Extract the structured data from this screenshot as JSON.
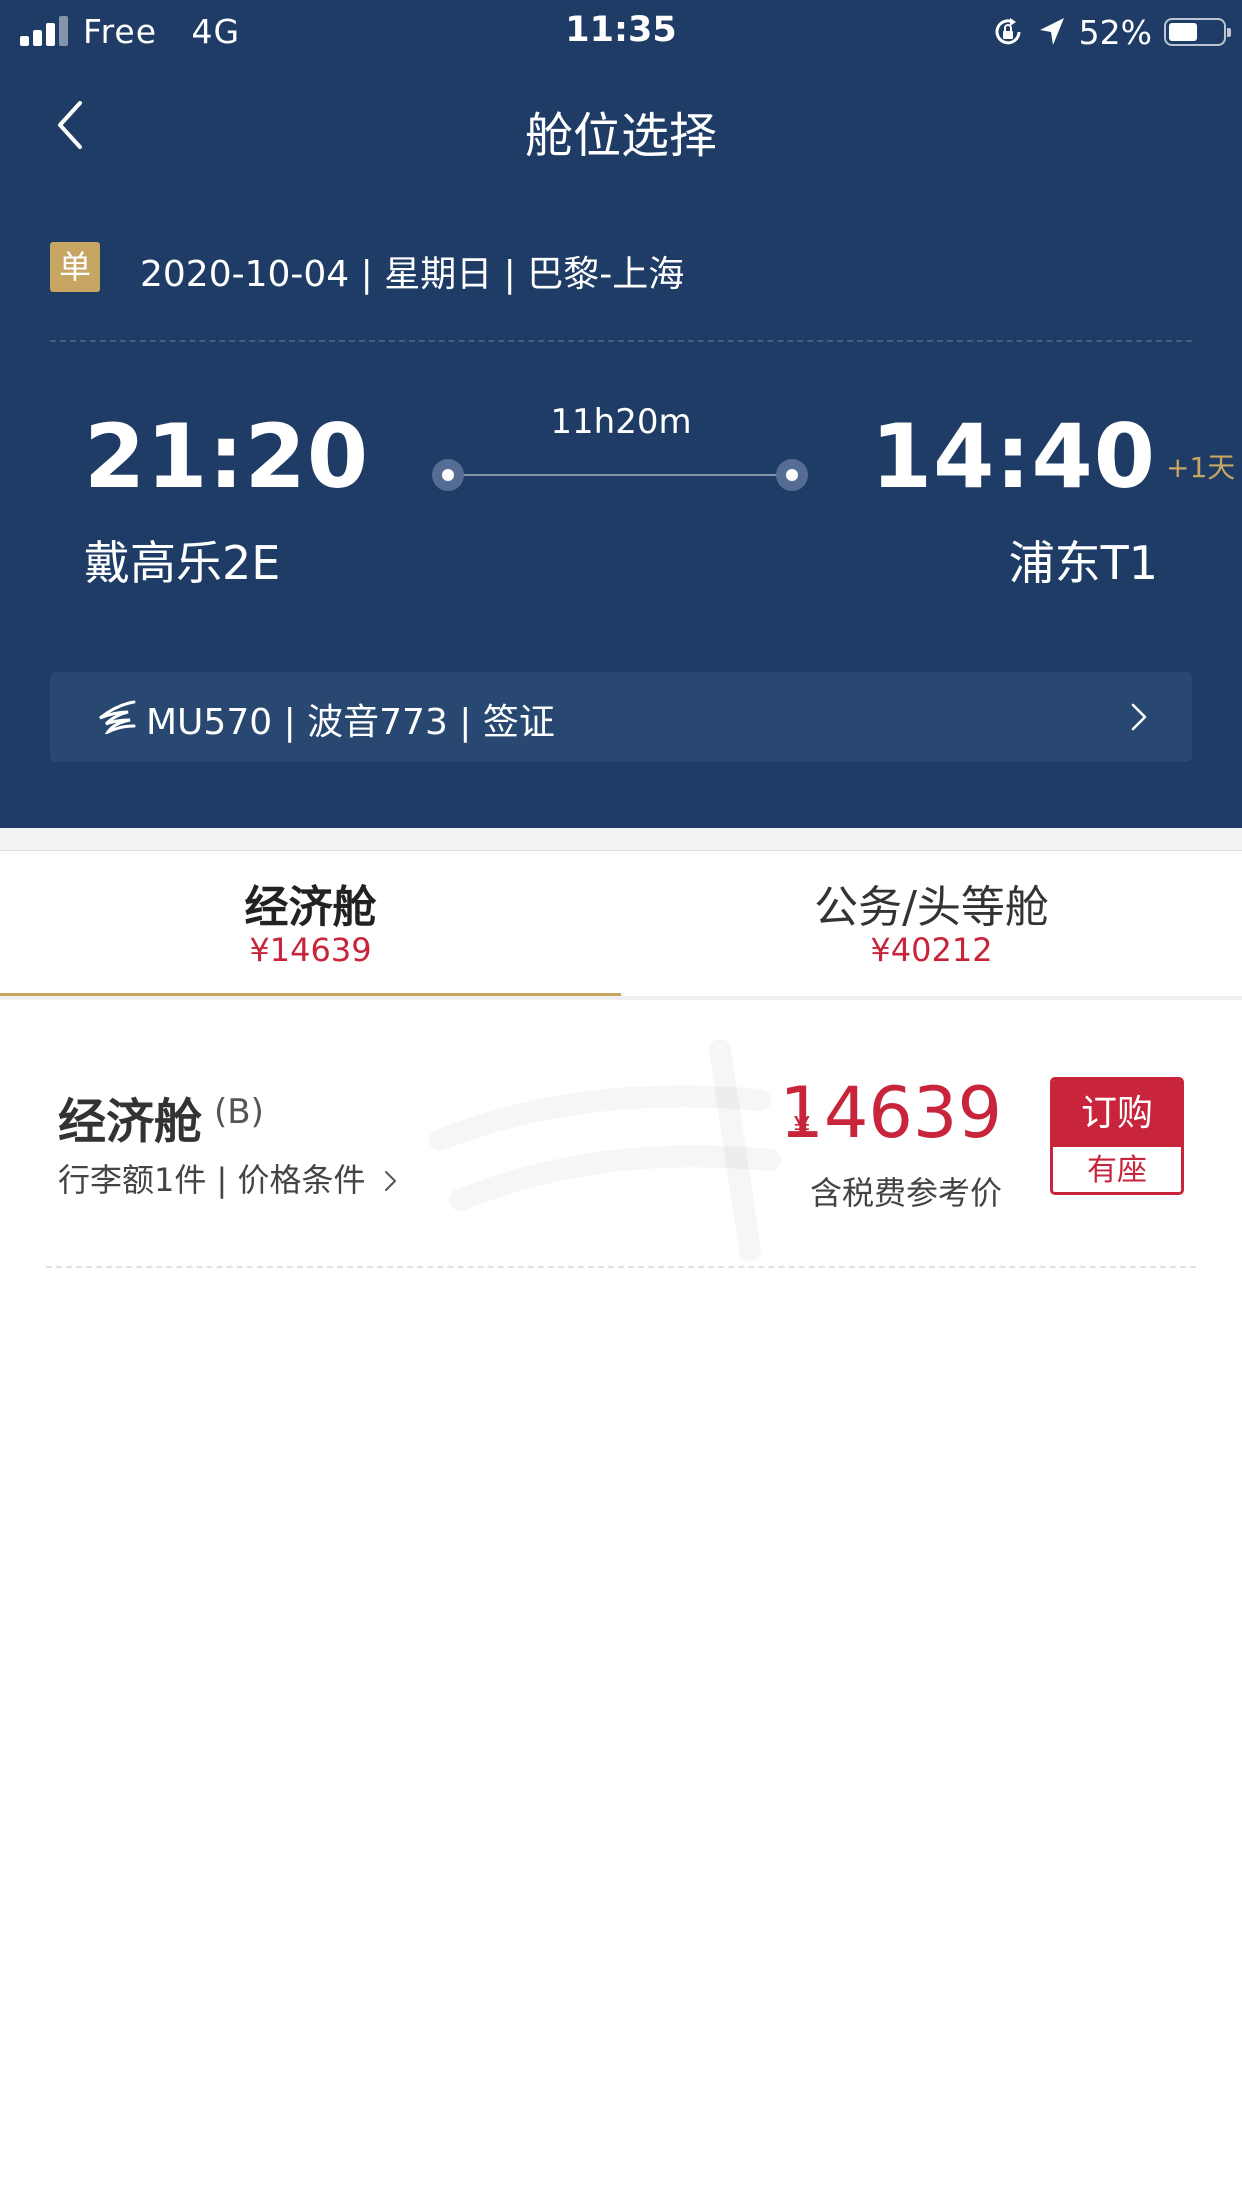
{
  "status_bar": {
    "carrier": "Free",
    "network": "4G",
    "time": "11:35",
    "battery": "52%",
    "battery_level": 0.52,
    "icons": [
      "signal-icon",
      "orientation-lock-icon",
      "location-arrow-icon",
      "battery-icon"
    ]
  },
  "nav": {
    "title": "舱位选择",
    "back_icon": "chevron-left-icon"
  },
  "trip": {
    "badge": "单",
    "info": "2020-10-04 | 星期日 | 巴黎-上海"
  },
  "flight": {
    "departure_time": "21:20",
    "arrival_time": "14:40",
    "day_offset": "+1天",
    "duration": "11h20m",
    "departure_airport": "戴高乐2E",
    "arrival_airport": "浦东T1",
    "details": "MU570 | 波音773 | 签证",
    "airline_icon": "china-eastern-logo-icon"
  },
  "tabs": [
    {
      "name": "经济舱",
      "price": "¥14639",
      "selected": true
    },
    {
      "name": "公务/头等舱",
      "price": "¥40212",
      "selected": false
    }
  ],
  "fares": [
    {
      "name": "经济舱",
      "code": "(B)",
      "terms": "行李额1件 | 价格条件",
      "currency": "¥",
      "price": "14639",
      "note": "含税费参考价",
      "book_label": "订购",
      "availability": "有座"
    }
  ],
  "colors": {
    "header_bg": "#1e3c66",
    "flight_bar_bg": "#294871",
    "accent_gold": "#c7a563",
    "price_red": "#c8253c"
  }
}
